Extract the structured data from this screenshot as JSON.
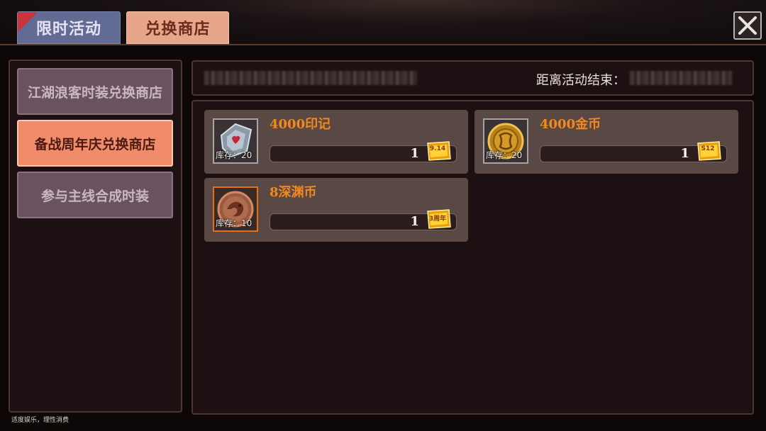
{
  "tabs": [
    {
      "label": "限时活动",
      "active": false
    },
    {
      "label": "兑换商店",
      "active": true
    }
  ],
  "sidebar": {
    "items": [
      {
        "label": "江湖浪客时装兑换商店",
        "active": false
      },
      {
        "label": "备战周年庆兑换商店",
        "active": true
      },
      {
        "label": "参与主线合成时装",
        "active": false
      }
    ],
    "notice": "适度娱乐，理性消费"
  },
  "info": {
    "countdown_label": "距离活动结束："
  },
  "items": [
    {
      "name": "4000印记",
      "stock": "库存：20",
      "quantity": "1",
      "ticket": "9.14",
      "icon": "seal-token-icon"
    },
    {
      "name": "4000金币",
      "stock": "库存：20",
      "quantity": "1",
      "ticket": "S12",
      "icon": "gold-coin-icon"
    },
    {
      "name": "8深渊币",
      "stock": "库存：10",
      "quantity": "1",
      "ticket": "3周年",
      "icon": "abyss-coin-icon"
    }
  ],
  "colors": {
    "accent_orange": "#f3881e",
    "active_tab": "#e7a58a",
    "inactive_tab": "#626b93",
    "active_side": "#f08c6c"
  }
}
